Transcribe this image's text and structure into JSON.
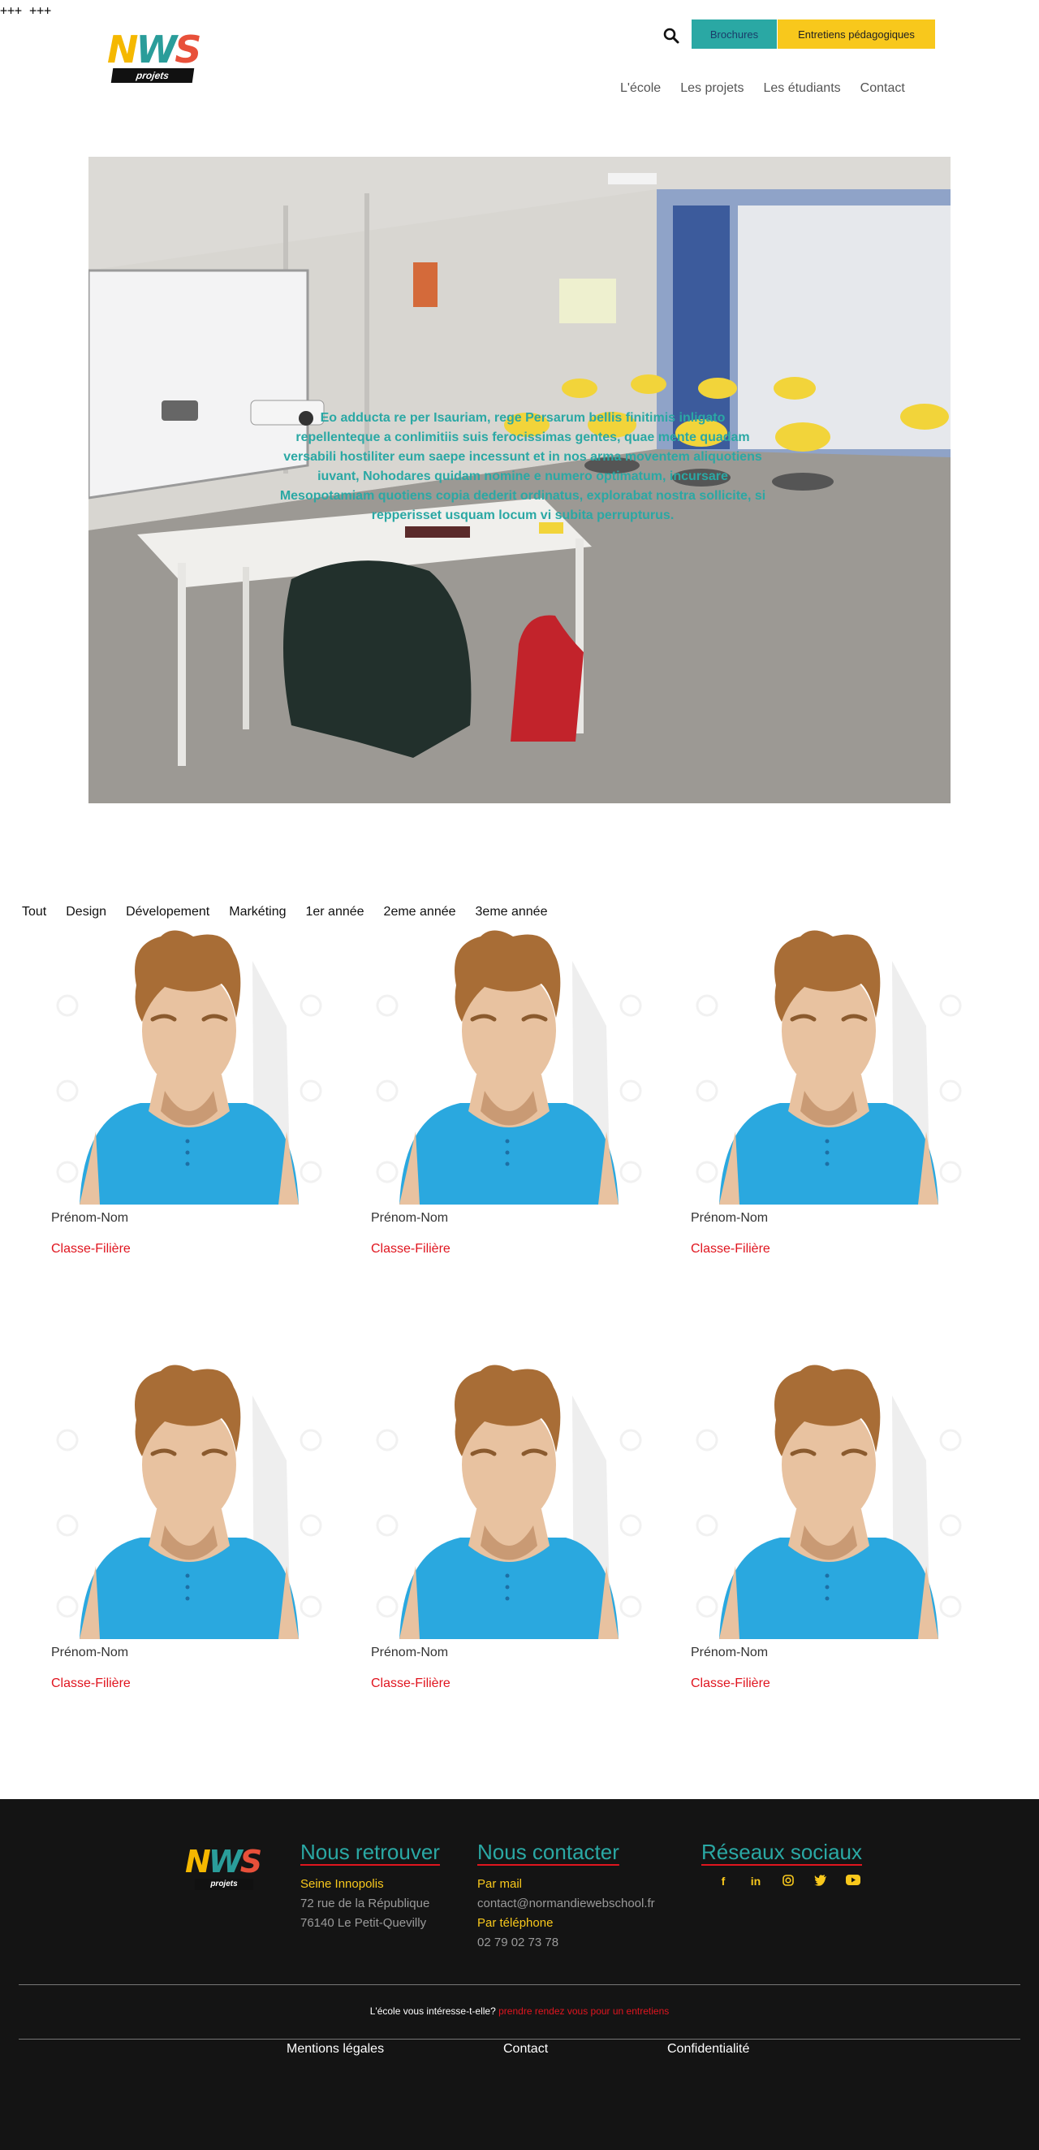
{
  "marker": "+++ +++",
  "logo": {
    "letter1": "N",
    "letter2": "W",
    "letter3": "S",
    "tagline": "projets"
  },
  "header": {
    "brochures_label": "Brochures",
    "entretiens_label": "Entretiens pédagogiques",
    "search_icon": "search-icon",
    "colors": {
      "teal": "#2aa8a4",
      "yellow": "#f8c81c",
      "red": "#e0151f"
    }
  },
  "nav": [
    "L'école",
    "Les projets",
    "Les étudiants",
    "Contact"
  ],
  "hero": {
    "text": "Eo adducta re per Isauriam, rege Persarum bellis finitimis inligato repellenteque a conlimitiis suis ferocissimas gentes, quae mente quadam versabili hostiliter eum saepe incessunt et in nos arma moventem aliquotiens iuvant, Nohodares quidam nomine e numero optimatum, incursare Mesopotamiam quotiens copia dederit ordinatus, explorabat nostra sollicite, si repperisset usquam locum vi subita perrupturus."
  },
  "filters": [
    "Tout",
    "Design",
    "Dévelopement",
    "Markéting",
    "1er année",
    "2eme année",
    "3eme année"
  ],
  "students": [
    {
      "name": "Prénom-Nom",
      "classe": "Classe-Filière"
    },
    {
      "name": "Prénom-Nom",
      "classe": "Classe-Filière"
    },
    {
      "name": "Prénom-Nom",
      "classe": "Classe-Filière"
    },
    {
      "name": "Prénom-Nom",
      "classe": "Classe-Filière"
    },
    {
      "name": "Prénom-Nom",
      "classe": "Classe-Filière"
    },
    {
      "name": "Prénom-Nom",
      "classe": "Classe-Filière"
    }
  ],
  "footer": {
    "retrouver": {
      "title": "Nous retrouver",
      "place": "Seine Innopolis",
      "address1": "72 rue de la République",
      "address2": "76140 Le Petit-Quevilly"
    },
    "contacter": {
      "title": "Nous contacter",
      "mail_label": "Par mail",
      "mail": "contact@normandiewebschool.fr",
      "phone_label": "Par téléphone",
      "phone": "02 79 02 73 78"
    },
    "reseaux": {
      "title": "Réseaux sociaux",
      "icons": [
        "facebook-icon",
        "linkedin-icon",
        "instagram-icon",
        "twitter-icon",
        "youtube-icon"
      ]
    },
    "cta_text": "L'école vous intéresse-t-elle?",
    "cta_link": "prendre rendez vous pour un entretiens",
    "links": [
      "Mentions légales",
      "Contact",
      "Confidentialité"
    ]
  }
}
